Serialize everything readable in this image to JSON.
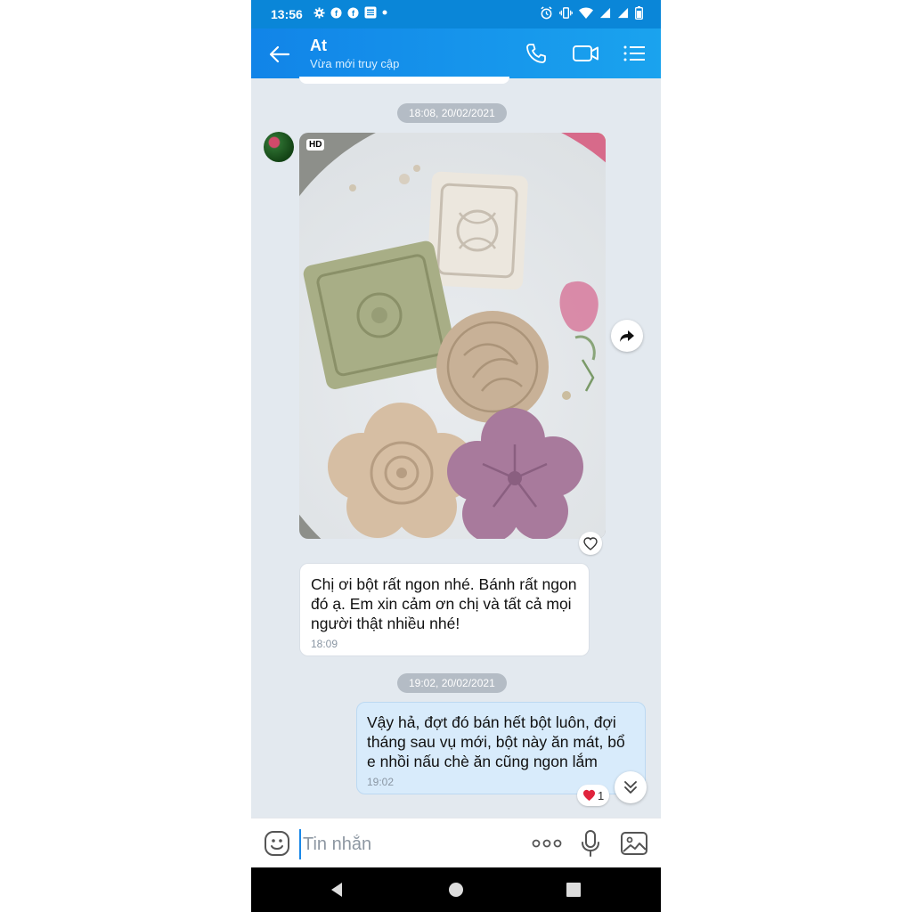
{
  "status_bar": {
    "time": "13:56"
  },
  "header": {
    "contact_name": "At",
    "contact_status": "Vừa mới truy cập"
  },
  "conversation": {
    "date_1": "18:08, 20/02/2021",
    "photo_badge": "HD",
    "incoming_message": {
      "text": "Chị ơi bột rất ngon nhé. Bánh rất ngon đó ạ. Em xin cảm ơn chị và tất cả mọi người thật nhiều nhé!",
      "time": "18:09"
    },
    "date_2": "19:02, 20/02/2021",
    "outgoing_message": {
      "text": "Vậy hả, đợt đó bán hết bột luôn, đợi tháng sau vụ mới, bột này ăn mát, bổ e nhồi nấu chè ăn cũng ngon lắm",
      "time": "19:02"
    },
    "reaction_count": "1"
  },
  "composer": {
    "placeholder": "Tin nhắn"
  },
  "colors": {
    "header": "#1184e8",
    "outgoing_bubble": "#d8ebfb",
    "background": "#e3e9ef"
  }
}
